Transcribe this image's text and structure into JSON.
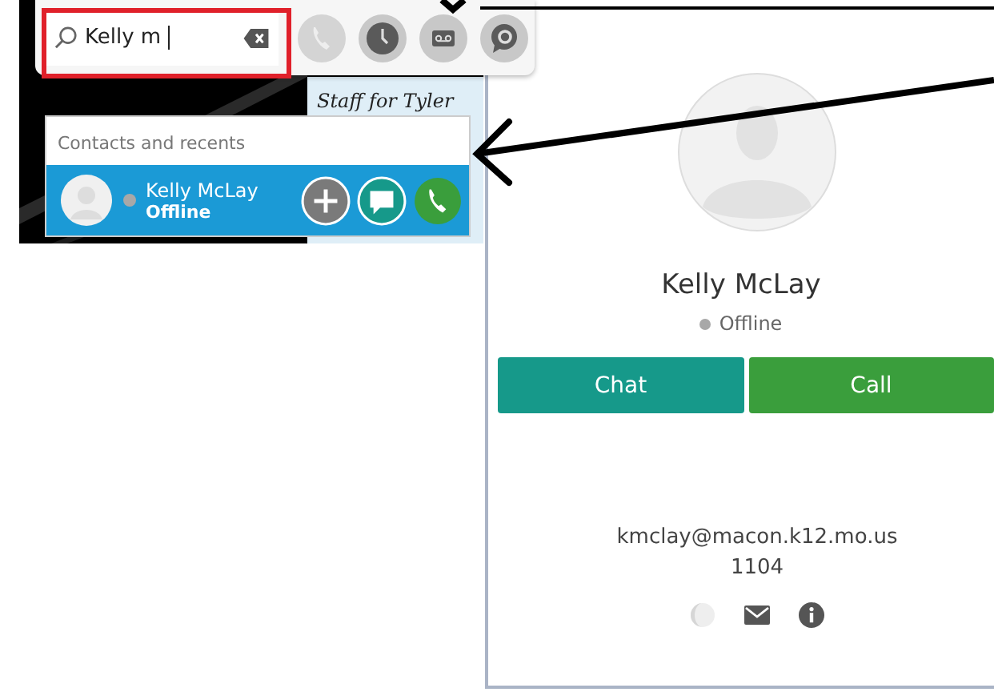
{
  "background_note": {
    "text": "Staff for Tyler"
  },
  "toolbar": {
    "search": {
      "value": "Kelly m"
    },
    "actions": [
      {
        "kind": "phone"
      },
      {
        "kind": "history"
      },
      {
        "kind": "voicemail"
      },
      {
        "kind": "chat"
      }
    ]
  },
  "results": {
    "header": "Contacts and recents",
    "items": [
      {
        "name": "Kelly McLay",
        "status": "Offline",
        "selected": true
      }
    ]
  },
  "contact_card": {
    "name": "Kelly McLay",
    "status": "Offline",
    "buttons": [
      {
        "label": "Chat",
        "kind": "chat"
      },
      {
        "label": "Call",
        "kind": "call"
      }
    ],
    "email": "kmclay@macon.k12.mo.us",
    "extension": "1104"
  }
}
